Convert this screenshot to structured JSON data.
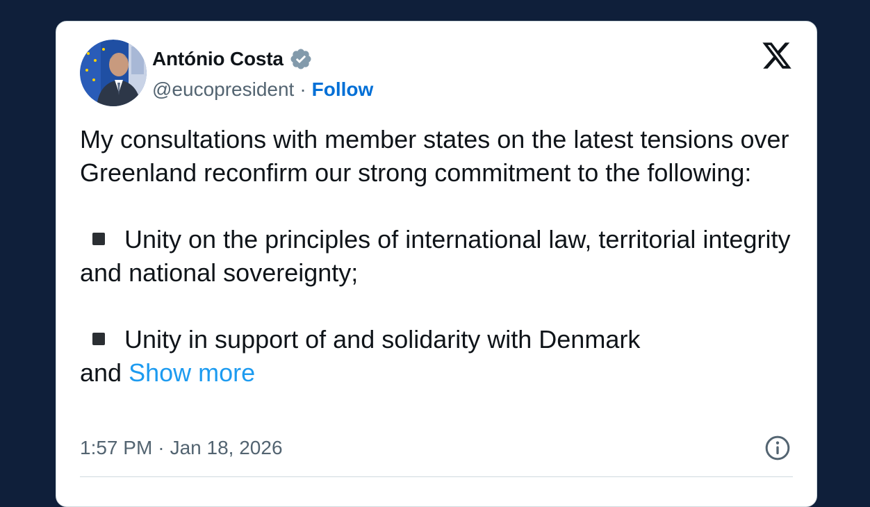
{
  "author": {
    "name": "António Costa",
    "handle": "@eucopresident",
    "separator": "·",
    "follow_label": "Follow",
    "verified": true
  },
  "tweet": {
    "intro": "My consultations with member states on the latest tensions over Greenland reconfirm our strong commitment to the following:",
    "bullets": [
      "Unity on the principles of international law, territorial integrity and national sovereignty;",
      "Unity in support of and solidarity with Denmark"
    ],
    "continuation": "and",
    "show_more_label": "Show more"
  },
  "meta": {
    "time": "1:57 PM",
    "separator": "·",
    "date": "Jan 18, 2026"
  },
  "icons": {
    "platform": "x-logo-icon",
    "verified": "verified-badge-icon",
    "info": "info-icon"
  },
  "colors": {
    "background": "#0f1f3a",
    "link": "#1d9bf0",
    "follow": "#006fd6",
    "text": "#0f1419",
    "secondary": "#536471"
  }
}
